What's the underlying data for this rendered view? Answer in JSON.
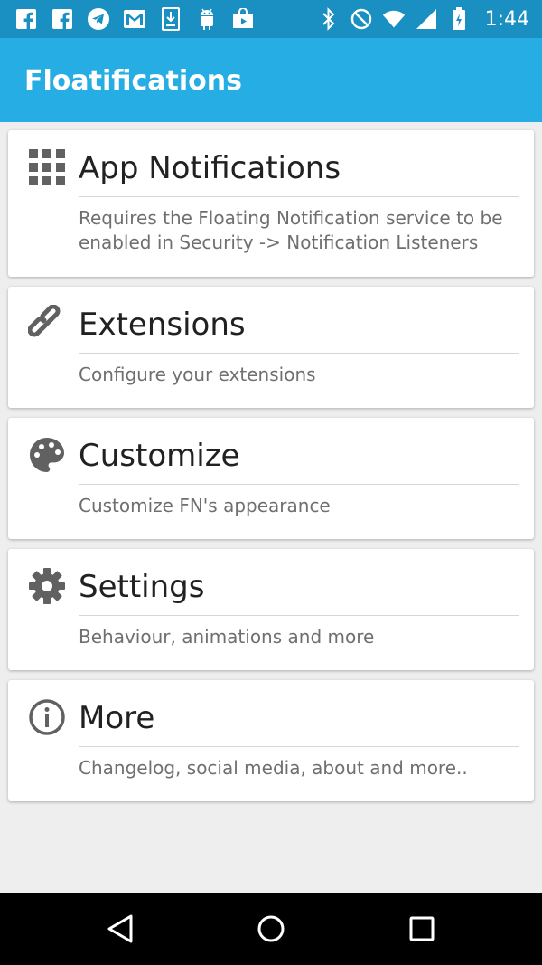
{
  "status_bar": {
    "time": "1:44",
    "left_icons": [
      "facebook-icon",
      "facebook-icon",
      "telegram-icon",
      "gmail-icon",
      "download-icon",
      "android-icon",
      "play-store-icon"
    ],
    "right_icons": [
      "bluetooth-icon",
      "do-not-disturb-icon",
      "wifi-icon",
      "signal-icon",
      "battery-icon"
    ]
  },
  "app_bar": {
    "title": "Floatifications"
  },
  "cards": [
    {
      "icon": "apps-grid-icon",
      "title": "App Notifications",
      "description": "Requires the Floating Notification service to be enabled in Security -> Notification Listeners"
    },
    {
      "icon": "link-icon",
      "title": "Extensions",
      "description": "Configure your extensions"
    },
    {
      "icon": "palette-icon",
      "title": "Customize",
      "description": "Customize FN's appearance"
    },
    {
      "icon": "gear-icon",
      "title": "Settings",
      "description": "Behaviour, animations and more"
    },
    {
      "icon": "info-icon",
      "title": "More",
      "description": "Changelog, social media, about and more.."
    }
  ],
  "nav_bar": {
    "buttons": [
      "back-icon",
      "home-icon",
      "recents-icon"
    ]
  },
  "colors": {
    "status_bar": "#1a8fc2",
    "app_bar": "#26ade3",
    "background": "#eeeeee",
    "card": "#ffffff",
    "icon": "#616161"
  }
}
